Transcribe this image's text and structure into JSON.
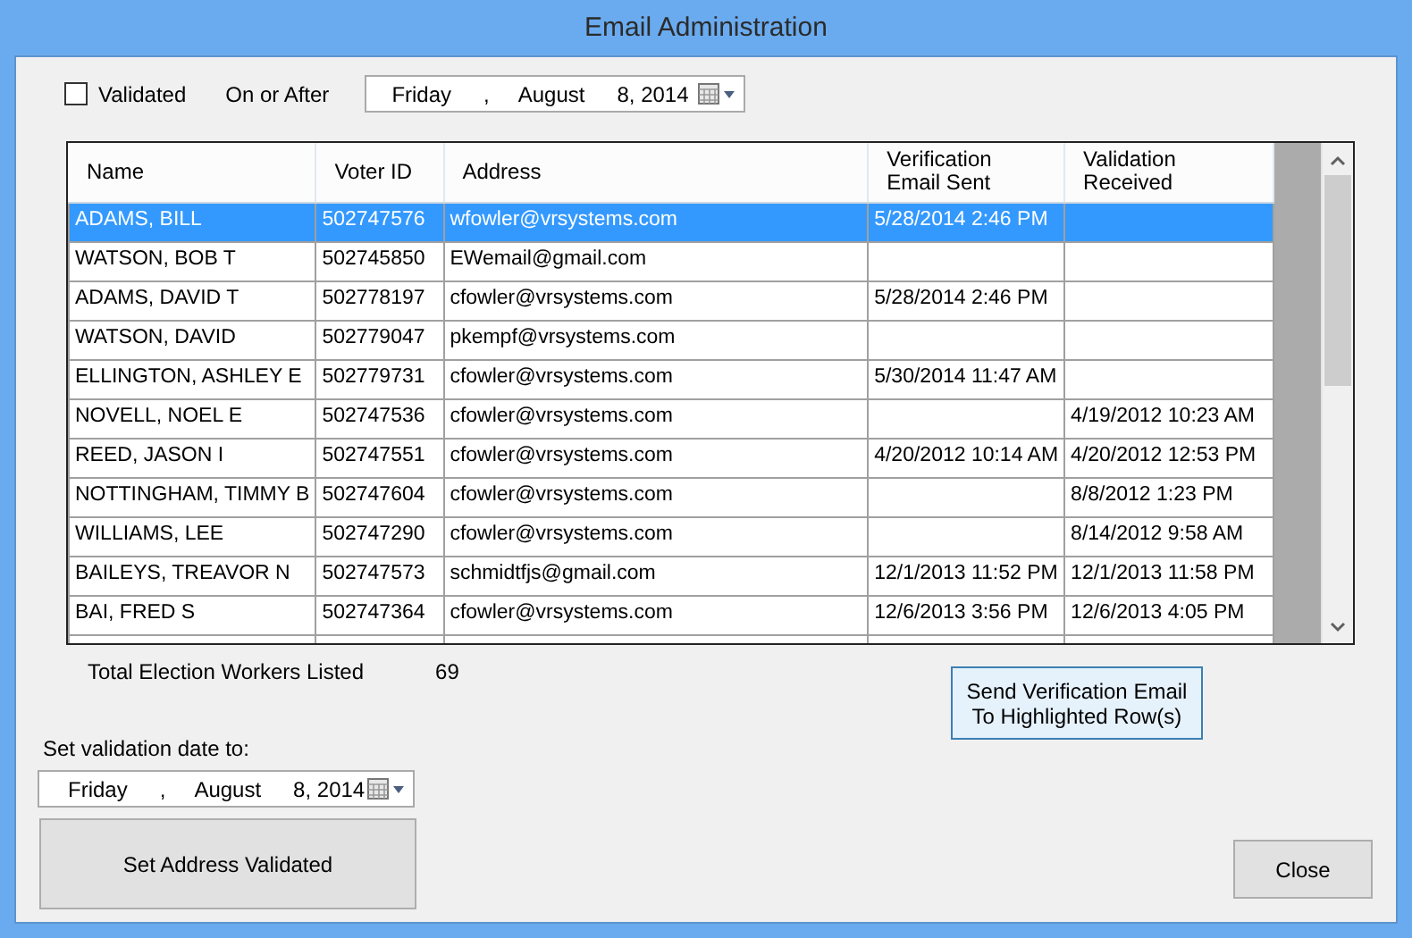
{
  "window": {
    "title": "Email Administration"
  },
  "filter": {
    "checkbox": {
      "label": "Validated",
      "checked": false
    },
    "label": "On or After",
    "date": {
      "weekday": "Friday",
      "separator": ",",
      "month": "August",
      "day_year": "8, 2014"
    }
  },
  "table": {
    "columns": [
      "Name",
      "Voter ID",
      "Address",
      "Verification\nEmail Sent",
      "Validation\nReceived"
    ],
    "rows": [
      {
        "cells": [
          "ADAMS, BILL",
          "502747576",
          "wfowler@vrsystems.com",
          "5/28/2014 2:46 PM",
          ""
        ],
        "selected": true
      },
      {
        "cells": [
          "WATSON, BOB T",
          "502745850",
          "EWemail@gmail.com",
          "",
          ""
        ],
        "selected": false
      },
      {
        "cells": [
          "ADAMS, DAVID T",
          "502778197",
          "cfowler@vrsystems.com",
          "5/28/2014 2:46 PM",
          ""
        ],
        "selected": false
      },
      {
        "cells": [
          "WATSON, DAVID",
          "502779047",
          "pkempf@vrsystems.com",
          "",
          ""
        ],
        "selected": false
      },
      {
        "cells": [
          "ELLINGTON, ASHLEY E",
          "502779731",
          "cfowler@vrsystems.com",
          "5/30/2014 11:47 AM",
          ""
        ],
        "selected": false
      },
      {
        "cells": [
          "NOVELL, NOEL E",
          "502747536",
          "cfowler@vrsystems.com",
          "",
          "4/19/2012 10:23 AM"
        ],
        "selected": false
      },
      {
        "cells": [
          "REED, JASON I",
          "502747551",
          "cfowler@vrsystems.com",
          "4/20/2012 10:14 AM",
          "4/20/2012 12:53 PM"
        ],
        "selected": false
      },
      {
        "cells": [
          "NOTTINGHAM, TIMMY B",
          "502747604",
          "cfowler@vrsystems.com",
          "",
          "8/8/2012 1:23 PM"
        ],
        "selected": false
      },
      {
        "cells": [
          "WILLIAMS, LEE",
          "502747290",
          "cfowler@vrsystems.com",
          "",
          "8/14/2012 9:58 AM"
        ],
        "selected": false
      },
      {
        "cells": [
          "BAILEYS, TREAVOR N",
          "502747573",
          "schmidtfjs@gmail.com",
          "12/1/2013 11:52 PM",
          "12/1/2013 11:58 PM"
        ],
        "selected": false
      },
      {
        "cells": [
          "BAI, FRED S",
          "502747364",
          "cfowler@vrsystems.com",
          "12/6/2013 3:56 PM",
          "12/6/2013 4:05 PM"
        ],
        "selected": false
      }
    ]
  },
  "total": {
    "label": "Total Election Workers Listed",
    "value": "69"
  },
  "send_button": "Send Verification Email To Highlighted Row(s)",
  "validation": {
    "label": "Set validation date to:",
    "date": {
      "weekday": "Friday",
      "separator": ",",
      "month": "August",
      "day_year": "8, 2014"
    },
    "button": "Set Address Validated"
  },
  "close_button": "Close"
}
